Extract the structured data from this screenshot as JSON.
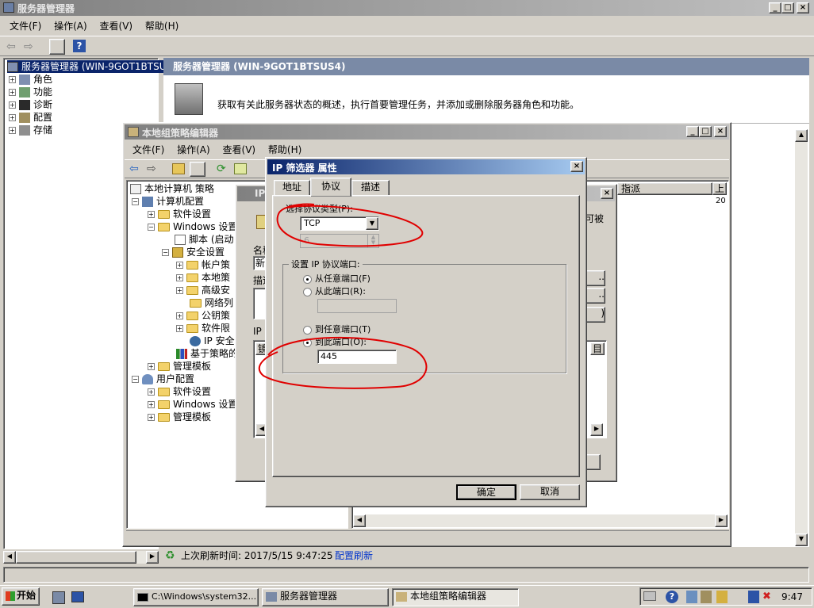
{
  "main_window": {
    "title": "服务器管理器",
    "menu": [
      "文件(F)",
      "操作(A)",
      "查看(V)",
      "帮助(H)"
    ],
    "tree": [
      {
        "label": "服务器管理器 (WIN-9GOT1BTSUS",
        "level": 0
      },
      {
        "label": "角色",
        "level": 1
      },
      {
        "label": "功能",
        "level": 1
      },
      {
        "label": "诊断",
        "level": 1
      },
      {
        "label": "配置",
        "level": 1
      },
      {
        "label": "存储",
        "level": 1
      }
    ],
    "panel_header": "服务器管理器 (WIN-9GOT1BTSUS4)",
    "panel_desc": "获取有关此服务器状态的概述，执行首要管理任务，并添加或删除服务器角色和功能。",
    "status_refresh": "上次刷新时间: 2017/5/15 9:47:25",
    "status_link": "配置刷新"
  },
  "gpedit_window": {
    "title": "本地组策略编辑器",
    "menu": [
      "文件(F)",
      "操作(A)",
      "查看(V)",
      "帮助(H)"
    ],
    "tree": [
      {
        "label": "本地计算机 策略"
      },
      {
        "label": "计算机配置"
      },
      {
        "label": "软件设置"
      },
      {
        "label": "Windows 设置"
      },
      {
        "label": "脚本 (启动"
      },
      {
        "label": "安全设置"
      },
      {
        "label": "帐户策"
      },
      {
        "label": "本地策"
      },
      {
        "label": "高级安"
      },
      {
        "label": "网络列"
      },
      {
        "label": "公钥策"
      },
      {
        "label": "软件限"
      },
      {
        "label": "IP 安全"
      },
      {
        "label": "基于策略的"
      },
      {
        "label": "管理模板"
      },
      {
        "label": "用户配置"
      },
      {
        "label": "软件设置"
      },
      {
        "label": "Windows 设置"
      },
      {
        "label": "管理模板"
      }
    ],
    "list_col_1": "指派",
    "list_col_2": "上",
    "list_cell": "20"
  },
  "middle_dialog": {
    "title": "IP",
    "name_label": "名称",
    "name_value": "新",
    "desc_label": "描述",
    "list_label": "IP",
    "col_label": "镜",
    "right_col": "目",
    "right_text": "可被"
  },
  "ip_filter_dialog": {
    "title": "IP 筛选器 属性",
    "tabs": [
      "地址",
      "协议",
      "描述"
    ],
    "active_tab": "协议",
    "protocol_type_label": "选择协议类型(P):",
    "protocol_value": "TCP",
    "protocol_number": "6",
    "port_group_label": "设置 IP 协议端口:",
    "from_any_port": "从任意端口(F)",
    "from_this_port": "从此端口(R):",
    "to_any_port": "到任意端口(T)",
    "to_this_port": "到此端口(O):",
    "to_port_value": "445",
    "ok": "确定",
    "cancel": "取消"
  },
  "taskbar": {
    "start": "开始",
    "items": [
      "C:\\Windows\\system32...",
      "服务器管理器",
      "本地组策略编辑器"
    ],
    "clock": "9:47"
  },
  "colors": {
    "active_title": "#0a246a",
    "inactive_title": "#808080",
    "annotation_red": "#e00000",
    "link": "#0033cc"
  }
}
